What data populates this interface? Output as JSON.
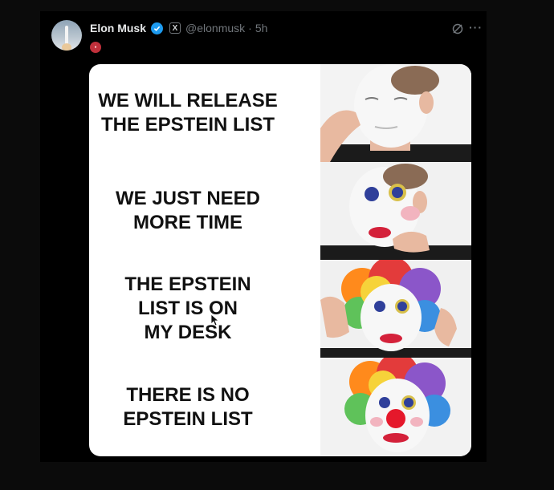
{
  "tweet": {
    "author_name": "Elon Musk",
    "verified_badge": "verified-badge-icon",
    "affiliation_badge": "X",
    "handle": "@elonmusk",
    "separator": "·",
    "timestamp": "5h",
    "more_icon": "more-options-icon",
    "grok_icon": "grok-icon",
    "avatar": "avatar-rocket-image"
  },
  "meme": {
    "panels": [
      {
        "text": "WE WILL RELEASE\nTHE EPSTEIN LIST",
        "stage": "white-base-makeup"
      },
      {
        "text": "WE JUST NEED\nMORE TIME",
        "stage": "face-paint-lipstick"
      },
      {
        "text": "THE EPSTEIN\nLIST IS ON\nMY DESK",
        "stage": "rainbow-wig"
      },
      {
        "text": "THERE IS NO\nEPSTEIN LIST",
        "stage": "full-clown-red-nose"
      }
    ]
  },
  "colors": {
    "page_bg": "#0b0b0b",
    "tweet_bg": "#000000",
    "name_text": "#e7e9ea",
    "muted_text": "#71767b",
    "verified": "#1d9bf0",
    "meme_bg": "#ffffff",
    "meme_text": "#111111"
  }
}
